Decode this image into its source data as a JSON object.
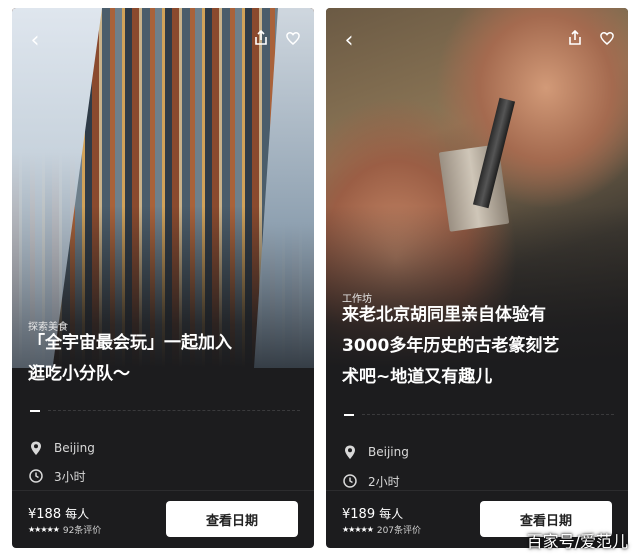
{
  "cards": [
    {
      "category": "探索美食",
      "title": "「全宇宙最会玩」一起加入\n逛吃小分队～",
      "location": "Beijing",
      "duration": "3小时",
      "price": "¥188",
      "price_unit": "每人",
      "stars": "★★★★★",
      "reviews": "92条评价",
      "button_label": "查看日期"
    },
    {
      "category": "工作坊",
      "title": "来老北京胡同里亲自体验有\n3000多年历史的古老篆刻艺\n术吧~地道又有趣儿",
      "location": "Beijing",
      "duration": "2小时",
      "price": "¥189",
      "price_unit": "每人",
      "stars": "★★★★★",
      "reviews": "207条评价",
      "button_label": "查看日期"
    }
  ],
  "icons": {
    "back": "chevron-left-icon",
    "share": "share-icon",
    "like": "heart-icon",
    "location": "location-pin-icon",
    "duration": "clock-icon"
  },
  "watermark": "百家号/爱范儿"
}
